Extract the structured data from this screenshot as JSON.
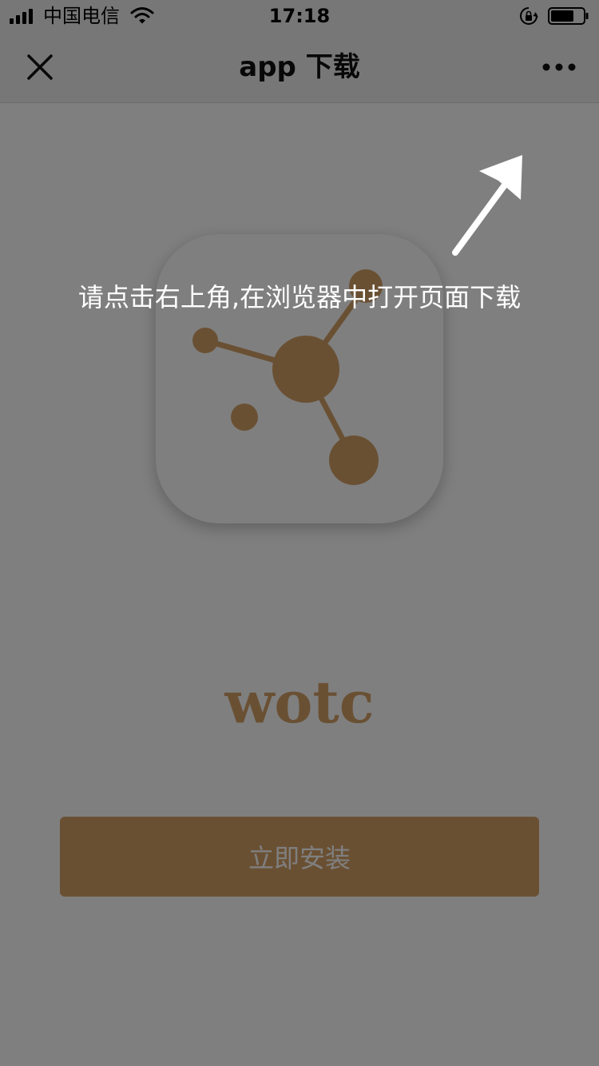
{
  "status_bar": {
    "carrier": "中国电信",
    "time": "17:18",
    "icons": [
      "signal-icon",
      "wifi-icon",
      "orientation-lock-icon",
      "battery-icon"
    ]
  },
  "nav_bar": {
    "title": "app 下载",
    "close_icon": "close-icon",
    "more_icon": "more-icon"
  },
  "app": {
    "name": "wotc",
    "icon": "molecule-logo-icon",
    "install_label": "立即安装"
  },
  "overlay": {
    "hint": "请点击右上角,在浏览器中打开页面下载",
    "arrow_icon": "arrow-up-right-icon"
  },
  "colors": {
    "brand": "#d4a167",
    "install_button": "#d4a167",
    "overlay": "rgba(0,0,0,0.5)",
    "bar_background": "#efefef"
  }
}
